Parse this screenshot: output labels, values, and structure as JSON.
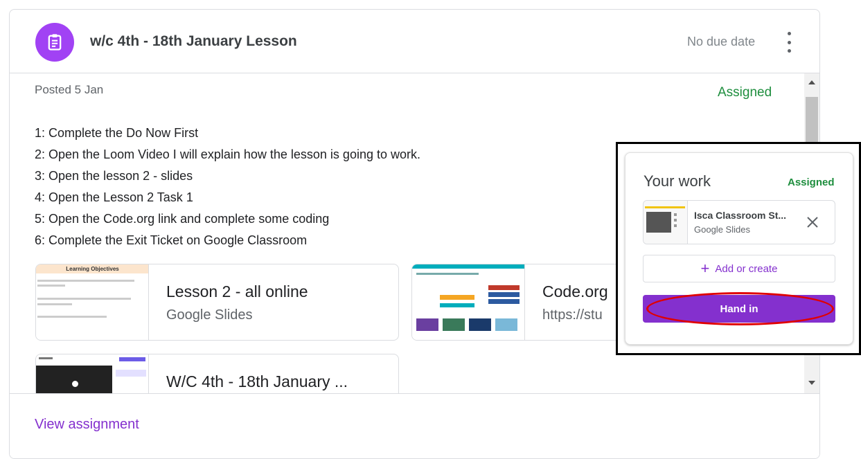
{
  "header": {
    "title": "w/c 4th - 18th January Lesson",
    "due": "No due date"
  },
  "meta": {
    "posted": "Posted 5 Jan",
    "status": "Assigned"
  },
  "instructions": [
    "1: Complete the Do Now First",
    "2: Open the Loom Video I will explain how the lesson is going to work.",
    "3: Open the lesson 2 - slides",
    "4: Open the Lesson 2 Task 1",
    "5: Open the Code.org link and complete some coding",
    "6: Complete the Exit Ticket on Google Classroom"
  ],
  "attachments": [
    {
      "title": "Lesson 2 - all online",
      "subtitle": "Google Slides",
      "thumb_heading": "Learning Objectives"
    },
    {
      "title": "Code.org",
      "subtitle": "https://stu"
    },
    {
      "title": "W/C 4th - 18th January ...",
      "subtitle": ""
    }
  ],
  "your_work": {
    "title": "Your work",
    "status": "Assigned",
    "file_name": "Isca Classroom St...",
    "file_type": "Google Slides",
    "add_label": "Add or create",
    "hand_in_label": "Hand in"
  },
  "footer": {
    "link": "View assignment"
  },
  "colors": {
    "accent": "#8430ce",
    "icon_bg": "#a142f4",
    "assigned": "#1e8e3e",
    "highlight_ring": "#e00000"
  }
}
